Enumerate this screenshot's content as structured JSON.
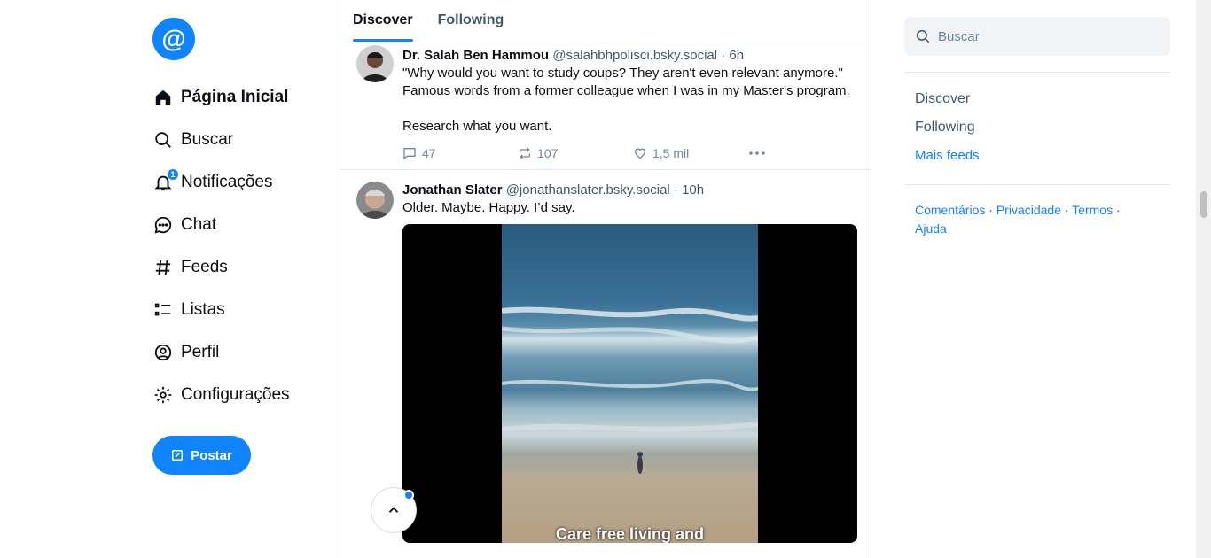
{
  "nav": {
    "logo": "@",
    "items": [
      {
        "label": "Página Inicial",
        "icon": "home-icon",
        "active": true
      },
      {
        "label": "Buscar",
        "icon": "search-icon"
      },
      {
        "label": "Notificações",
        "icon": "bell-icon",
        "badge": "1"
      },
      {
        "label": "Chat",
        "icon": "chat-icon"
      },
      {
        "label": "Feeds",
        "icon": "hash-icon"
      },
      {
        "label": "Listas",
        "icon": "list-icon"
      },
      {
        "label": "Perfil",
        "icon": "profile-icon"
      },
      {
        "label": "Configurações",
        "icon": "gear-icon"
      }
    ],
    "post_button": "Postar"
  },
  "tabs": [
    {
      "label": "Discover",
      "active": true
    },
    {
      "label": "Following"
    }
  ],
  "posts": [
    {
      "name": "Dr. Salah Ben Hammou",
      "handle": "@salahbhpolisci.bsky.social",
      "time": "· 6h",
      "text": "\"Why would you want to study coups? They aren't even relevant anymore.\" Famous words from a former colleague when I was in my Master's program.\n\nResearch what you want.",
      "replies": "47",
      "reposts": "107",
      "likes": "1,5 mil"
    },
    {
      "name": "Jonathan Slater",
      "handle": "@jonathanslater.bsky.social",
      "time": "· 10h",
      "text": "Older.  Maybe. Happy. I’d say.",
      "video_caption": "Care free living and"
    }
  ],
  "right": {
    "search_placeholder": "Buscar",
    "feeds": [
      "Discover",
      "Following"
    ],
    "more_feeds": "Mais feeds",
    "footer": [
      "Comentários",
      "Privacidade",
      "Termos",
      "Ajuda"
    ],
    "footer_sep": "·"
  },
  "colors": {
    "accent": "#1083fe",
    "text": "#0b0f14",
    "muted": "#42576c",
    "border": "#e2e7ee"
  }
}
